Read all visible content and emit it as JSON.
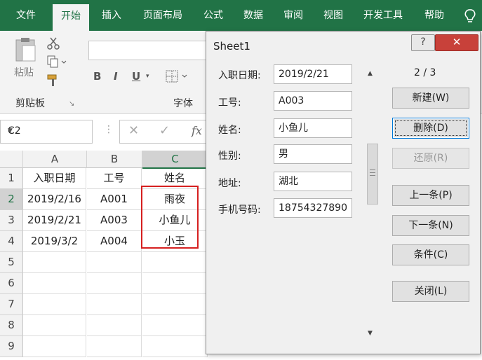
{
  "ribbon_tabs": [
    "文件",
    "开始",
    "插入",
    "页面布局",
    "公式",
    "数据",
    "审阅",
    "视图",
    "开发工具",
    "帮助"
  ],
  "ribbon": {
    "paste_label": "粘贴",
    "clipboard_label": "剪贴板",
    "font_group_label": "字体",
    "bold": "B",
    "italic": "I",
    "underline": "U"
  },
  "formula_bar": {
    "name_box": "C2",
    "fx": "fx",
    "cancel": "✕",
    "enter": "✓"
  },
  "sheet": {
    "columns": [
      "A",
      "B",
      "C"
    ],
    "row_numbers": [
      "1",
      "2",
      "3",
      "4",
      "5",
      "6",
      "7",
      "8",
      "9"
    ],
    "rows": [
      [
        "入职日期",
        "工号",
        "姓名"
      ],
      [
        "2019/2/16",
        "A001",
        "雨夜"
      ],
      [
        "2019/2/21",
        "A003",
        "小鱼儿"
      ],
      [
        "2019/3/2",
        "A004",
        "小玉"
      ]
    ]
  },
  "dialog": {
    "title": "Sheet1",
    "help": "?",
    "close": "✕",
    "record_counter": "2 / 3",
    "fields": [
      {
        "label": "入职日期:",
        "value": "2019/2/21"
      },
      {
        "label": "工号:",
        "value": "A003"
      },
      {
        "label": "姓名:",
        "value": "小鱼儿"
      },
      {
        "label": "性别:",
        "value": "男"
      },
      {
        "label": "地址:",
        "value": "湖北"
      },
      {
        "label": "手机号码:",
        "value": "18754327890"
      }
    ],
    "buttons": {
      "new": "新建(W)",
      "delete": "删除(D)",
      "restore": "还原(R)",
      "prev": "上一条(P)",
      "next": "下一条(N)",
      "criteria": "条件(C)",
      "close": "关闭(L)"
    }
  },
  "colors": {
    "excel_green": "#217346",
    "highlight_red": "#d62020",
    "close_red": "#c8413a"
  }
}
